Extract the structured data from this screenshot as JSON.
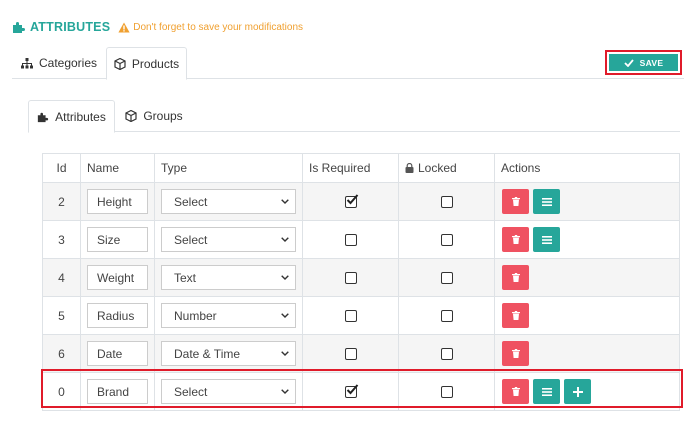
{
  "header": {
    "title": "ATTRIBUTES",
    "warning": "Don't forget to save your modifications"
  },
  "top_tabs": [
    {
      "label": "Categories",
      "icon": "sitemap-icon",
      "active": false
    },
    {
      "label": "Products",
      "icon": "cube-icon",
      "active": true
    }
  ],
  "save_label": "SAVE",
  "sub_tabs": [
    {
      "label": "Attributes",
      "icon": "puzzle-icon",
      "active": true
    },
    {
      "label": "Groups",
      "icon": "cube-icon",
      "active": false
    }
  ],
  "table": {
    "columns": [
      "Id",
      "Name",
      "Type",
      "Is Required",
      "Locked",
      "Actions"
    ],
    "rows": [
      {
        "id": "2",
        "name": "Height",
        "type": "Select",
        "required": true,
        "locked": false,
        "actions": [
          "delete",
          "list"
        ]
      },
      {
        "id": "3",
        "name": "Size",
        "type": "Select",
        "required": false,
        "locked": false,
        "actions": [
          "delete",
          "list"
        ]
      },
      {
        "id": "4",
        "name": "Weight",
        "type": "Text",
        "required": false,
        "locked": false,
        "actions": [
          "delete"
        ]
      },
      {
        "id": "5",
        "name": "Radius",
        "type": "Number",
        "required": false,
        "locked": false,
        "actions": [
          "delete"
        ]
      },
      {
        "id": "6",
        "name": "Date",
        "type": "Date & Time",
        "required": false,
        "locked": false,
        "actions": [
          "delete"
        ]
      },
      {
        "id": "0",
        "name": "Brand",
        "type": "Select",
        "required": true,
        "locked": false,
        "actions": [
          "delete",
          "list",
          "add"
        ]
      }
    ]
  },
  "colors": {
    "accent": "#26a69a",
    "danger": "#ef5261",
    "warning": "#f0a030",
    "highlight": "#e01b2a"
  }
}
